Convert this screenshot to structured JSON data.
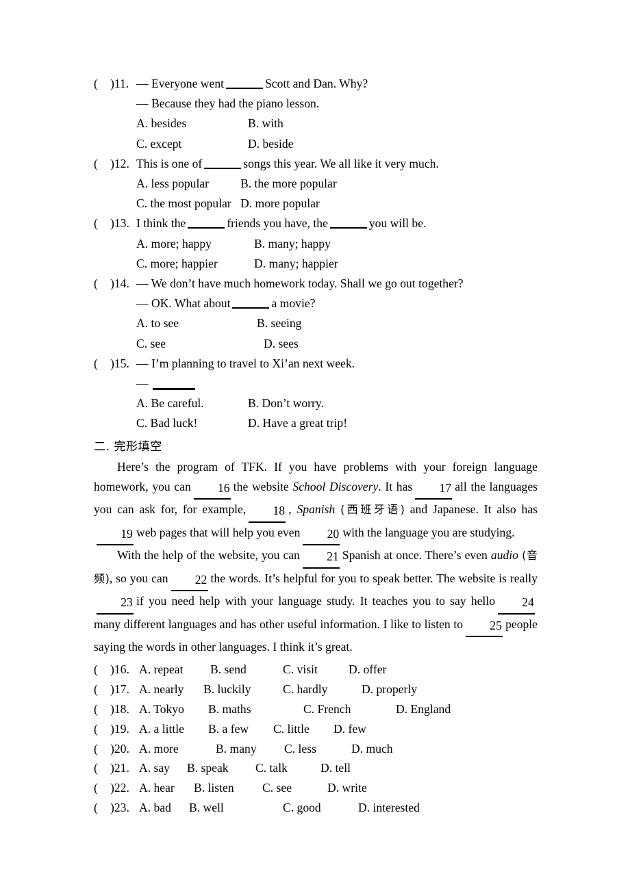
{
  "document": {
    "type": "english-exam-worksheet",
    "background_color": "#ffffff",
    "text_color": "#000000"
  },
  "multiple_choice": {
    "questions": [
      {
        "paren": "(",
        "number": ")11.",
        "prompt_prefix": "— Everyone went",
        "prompt_suffix": "Scott and Dan. Why?",
        "reply": "— Because they had the piano lesson.",
        "options": {
          "a": "A. besides",
          "b": "B. with",
          "c": "C. except",
          "d": "D. beside"
        }
      },
      {
        "paren": "(",
        "number": ")12.",
        "prompt_prefix": "This is one of",
        "prompt_suffix": "songs this year. We all like it very much.",
        "options": {
          "a": "A. less popular",
          "b": "B. the more popular",
          "c": "C. the most popular",
          "d": "D. more popular"
        }
      },
      {
        "paren": "(",
        "number": ")13.",
        "prompt_prefix": "I think the",
        "prompt_middle": "friends you have, the",
        "prompt_suffix": "you will be.",
        "options": {
          "a": "A. more; happy",
          "b": "B. many; happy",
          "c": "C. more; happier",
          "d": "D. many; happier"
        }
      },
      {
        "paren": "(",
        "number": ")14.",
        "prompt_prefix": "— We don’t have much homework today. Shall we go out together?",
        "reply_prefix": "— OK. What about",
        "reply_suffix": "a movie?",
        "options": {
          "a": "A. to see",
          "b": "B. seeing",
          "c": "C. see",
          "d": "D. sees"
        }
      },
      {
        "paren": "(",
        "number": ")15.",
        "prompt_prefix": "— I’m planning to travel to Xi’an next week.",
        "reply_dash": "—",
        "options": {
          "a": "A. Be careful.",
          "b": "B. Don’t worry.",
          "c": "C. Bad luck!",
          "d": "D. Have a great trip!"
        }
      }
    ]
  },
  "cloze_section": {
    "heading": "二. 完形填空",
    "paragraph1": {
      "s1": "Here’s the program of TFK. If you have problems with your foreign language homework, you can",
      "blank16": "16",
      "s2": "the website",
      "italic_title": "School Discovery",
      "s3": ". It has",
      "blank17": "17",
      "s4": "all the languages you can ask for, for example,",
      "blank18": "18",
      "s5": ",",
      "italic_spanish": "Spanish",
      "chinese_spanish": "(西班牙语)",
      "s6": "and Japanese. It also has",
      "blank19": "19",
      "s7": "web pages that will help you even",
      "blank20": "20",
      "s8": "with the language you are studying."
    },
    "paragraph2": {
      "s1": "With the help of the website, you can",
      "blank21": "21",
      "s2": "Spanish at once. There’s even",
      "italic_audio": "audio",
      "chinese_audio": "(音频)",
      "s3": ", so you can",
      "blank22": "22",
      "s4": "the words. It’s helpful for you to speak better. The website is really",
      "blank23": "23",
      "s5": "if you need help with your language study. It teaches you to say hello",
      "blank24": "24",
      "s6": "many different languages and has other useful information. I like to listen to",
      "blank25": "25",
      "s7": "people saying the words in other languages. I think it’s great."
    }
  },
  "cloze_answers": {
    "rows": [
      {
        "paren": "(",
        "number": ")16.",
        "a": "A. repeat",
        "b": "B. send",
        "c": "C. visit",
        "d": "D. offer",
        "wa": 104,
        "wb": 106,
        "wc": 96
      },
      {
        "paren": "(",
        "number": ")17.",
        "a": "A. nearly",
        "b": "B. luckily",
        "c": "C. hardly",
        "d": "D. properly",
        "wa": 94,
        "wb": 116,
        "wc": 115
      },
      {
        "paren": "(",
        "number": ")18.",
        "a": "A. Tokyo",
        "b": "B. maths",
        "c": "C. French",
        "d": "D. England",
        "wa": 101,
        "wb": 139,
        "wc": 135
      },
      {
        "paren": "(",
        "number": ")19.",
        "a": "A. a little",
        "b": "B. a few",
        "c": "C. little",
        "d": "D. few",
        "wa": 101,
        "wb": 95,
        "wc": 88
      },
      {
        "paren": "(",
        "number": ")20.",
        "a": "A. more",
        "b": "B. many",
        "c": "C. less",
        "d": "D. much",
        "wa": 112,
        "wb": 100,
        "wc": 98
      },
      {
        "paren": "(",
        "number": ")21.",
        "a": "A. say",
        "b": "B. speak",
        "c": "C. talk",
        "d": "D. tell",
        "wa": 70,
        "wb": 100,
        "wc": 95
      },
      {
        "paren": "(",
        "number": ")22.",
        "a": "A. hear",
        "b": "B. listen",
        "c": "C. see",
        "d": "D. write",
        "wa": 80,
        "wb": 100,
        "wc": 95
      },
      {
        "paren": "(",
        "number": ")23.",
        "a": "A. bad",
        "b": "B. well",
        "c": "C. good",
        "d": "D. interested",
        "wa": 73,
        "wb": 137,
        "wc": 110
      }
    ]
  }
}
